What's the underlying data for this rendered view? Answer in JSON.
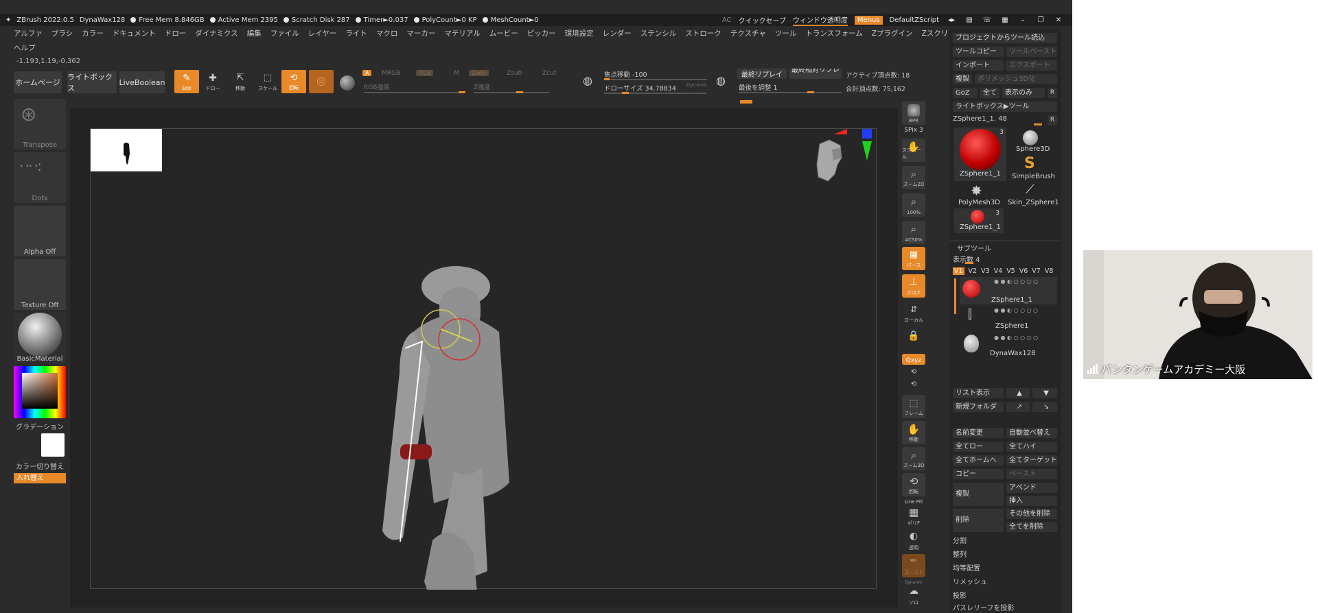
{
  "titlebar": {
    "app": "ZBrush 2022.0.5",
    "doc": "DynaWax128",
    "free_mem": "Free Mem 8.846GB",
    "active_mem": "Active Mem 2395",
    "scratch": "Scratch Disk 287",
    "timer": "Timer►0.037",
    "polycount": "PolyCount►0 KP",
    "meshcount": "MeshCount►0",
    "ac": "AC",
    "quicksave": "クイックセーブ",
    "transparency": "ウィンドウ透明度",
    "menus": "Menus",
    "zscript": "DefaultZScript"
  },
  "menubar": [
    "アルファ",
    "ブラシ",
    "カラー",
    "ドキュメント",
    "ドロー",
    "ダイナミクス",
    "編集",
    "ファイル",
    "レイヤー",
    "ライト",
    "マクロ",
    "マーカー",
    "マテリアル",
    "ムービー",
    "ピッカー",
    "環境設定",
    "レンダー",
    "ステンシル",
    "ストローク",
    "テクスチャ",
    "ツール",
    "トランスフォーム",
    "Zプラグイン",
    "Zスクリプト"
  ],
  "help": "ヘルプ",
  "coords": "-1.193,1.19,-0.362",
  "shelf": {
    "home": "ホームページ",
    "lightbox": "ライトボックス",
    "liveboolean": "LiveBoolean",
    "edit": "Edit",
    "draw": "ドロー",
    "move": "移動",
    "scale": "スケール",
    "rotate": "回転",
    "a": "A",
    "mrgb": "MRGB",
    "rgb": "RGB",
    "m": "M",
    "zadd": "Zadd",
    "zsub": "Zsub",
    "zcut": "Zcut",
    "rgb_intensity": "RGB強度",
    "z_intensity": "Z強度",
    "focal_shift": "焦点移動 -100",
    "draw_size": "ドローサイズ 34.78834",
    "dynamic": "Dynamic",
    "last_replay": "最終リプレイ",
    "last_rel_replay": "最終相対リプレー",
    "adjust_last": "最後を調整 1",
    "active_points": "アクティブ頂点数: 18",
    "total_points": "合計頂点数: 75,162"
  },
  "left": {
    "transpose": "Transpose",
    "dots": "Dots",
    "alpha": "Alpha Off",
    "texture": "Texture Off",
    "material": "BasicMaterial",
    "gradient": "グラデーション",
    "switch_color": "カラー切り替え",
    "swap": "入れ替え"
  },
  "right_shelf": {
    "spix": "SPix 3",
    "bpr": "BPR",
    "scroll": "スクロール",
    "zoom2d": "ズーム2D",
    "pct100": "100%",
    "ac50": "AC50%",
    "persp": "パース",
    "floor": "フロア",
    "local": "ローカル",
    "xyz": "Qxyz",
    "frame": "フレーム",
    "move": "移動",
    "zoom3d": "ズーム3D",
    "rotate": "回転",
    "linefill": "Line Fill",
    "polyf": "ポリF",
    "transp": "透明",
    "ghost": "ゴースト",
    "dynamic": "Dynamic",
    "solo": "ソロ"
  },
  "tool": {
    "load_from_project": "プロジェクトからツール読込",
    "copy_tool": "ツールコピー",
    "paste_tool": "ツールペースト",
    "import": "インポート",
    "export": "エクスポート",
    "clone": "複製",
    "make_polymesh": "ポリメッシュ3D化",
    "goz": "GoZ",
    "all": "全て",
    "visible": "表示のみ",
    "r": "R",
    "lightbox_tool": "ライトボックス▶ツール",
    "current_tool": "ZSphere1_1. 48",
    "thumbs": [
      {
        "label": "ZSphere1_1",
        "badge": "3"
      },
      {
        "label": "Sphere3D"
      },
      {
        "label": "SimpleBrush"
      },
      {
        "label": "PolyMesh3D"
      },
      {
        "label": "Skin_ZSphere1"
      },
      {
        "label": "ZSphere1_1",
        "badge": "3"
      }
    ],
    "subtool_header": "サブツール",
    "visible_count": "表示数 4",
    "versions": [
      "V1",
      "V2",
      "V3",
      "V4",
      "V5",
      "V6",
      "V7",
      "V8"
    ],
    "subtools": [
      "ZSphere1_1",
      "ZSphere1",
      "DynaWax128"
    ],
    "list_all": "リスト表示",
    "new_folder": "新規フォルダ",
    "rename": "名前変更",
    "auto_reorder": "自動並べ替え",
    "all_low": "全てロー",
    "all_high": "全てハイ",
    "all_to_home": "全てホームへ",
    "all_to_target": "全てターゲットへ",
    "copy": "コピー",
    "paste": "ペースト",
    "duplicate": "複製",
    "append": "アペンド",
    "insert": "挿入",
    "delete": "削除",
    "delete_other": "その他を削除",
    "delete_all": "全てを削除",
    "split": "分割",
    "merge": "整列",
    "distribute": "均等配置",
    "remesh": "リメッシュ",
    "project": "投影",
    "extract": "パスレリーフを投影"
  },
  "webcam": {
    "label": "パンタンゲームアカデミー大阪"
  }
}
